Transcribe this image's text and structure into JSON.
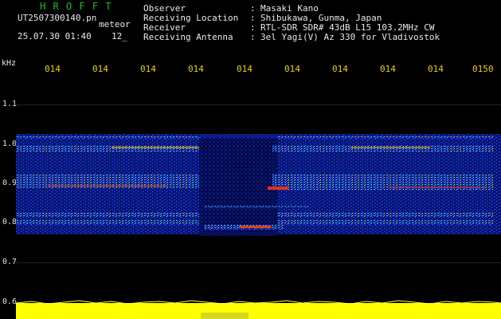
{
  "header": {
    "brand": "H R O F F T",
    "filename": "UT2507300140.pn",
    "tag": "meteor",
    "datetime": "25.07.30 01:40",
    "number": "12_"
  },
  "info": [
    {
      "label": "Observer",
      "colon": ":",
      "value": "Masaki Kano"
    },
    {
      "label": "Receiving Location",
      "colon": ":",
      "value": "Shibukawa, Gunma, Japan"
    },
    {
      "label": "Receiver",
      "colon": ":",
      "value": "RTL-SDR SDR# 43dB L15 103.2MHz CW"
    },
    {
      "label": "Receiving Antenna",
      "colon": ":",
      "value": "3el Yagi(V) Az 330 for Vladivostok"
    }
  ],
  "axis": {
    "unit": "kHz",
    "freq_ticks": [
      "1.1",
      "1.0",
      "0.9",
      "0.8",
      "0.7",
      "0.6"
    ],
    "time_ticks": [
      "014",
      "014",
      "014",
      "014",
      "014",
      "014",
      "014",
      "014",
      "014",
      "0150"
    ]
  },
  "colors": {
    "background": "#000000",
    "brand": "#1eb81e",
    "time_labels": "#f0d000",
    "signal_band": "#ffff00",
    "noise": "#0a1a8c"
  }
}
